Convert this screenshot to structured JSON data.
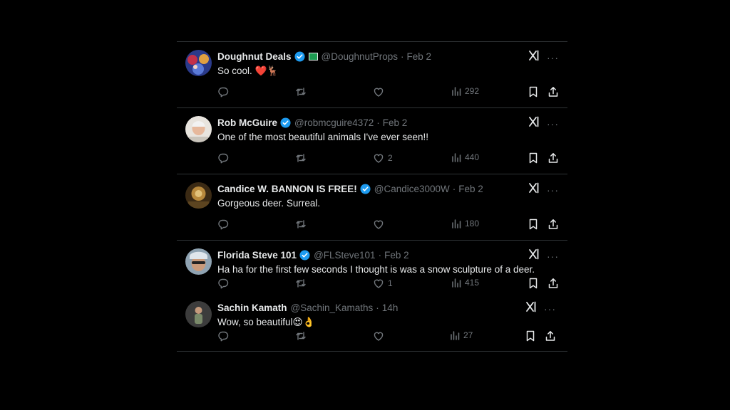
{
  "tweets": [
    {
      "name": "Doughnut Deals",
      "handle": "@DoughnutProps",
      "date": "Feb 2",
      "text": "So cool. ❤️🦌",
      "verified": true,
      "affiliate_badge": true,
      "reply_count": "",
      "retweet_count": "",
      "like_count": "",
      "views": "292",
      "avatar_color": "#3a4f9a"
    },
    {
      "name": "Rob McGuire",
      "handle": "@robmcguire4372",
      "date": "Feb 2",
      "text": "One of the most beautiful animals I've ever seen!!",
      "verified": true,
      "affiliate_badge": false,
      "reply_count": "",
      "retweet_count": "",
      "like_count": "2",
      "views": "440",
      "avatar_color": "#d9d2c9"
    },
    {
      "name": "Candice W. BANNON IS FREE!",
      "handle": "@Candice3000W",
      "date": "Feb 2",
      "text": "Gorgeous deer. Surreal.",
      "verified": true,
      "affiliate_badge": false,
      "reply_count": "",
      "retweet_count": "",
      "like_count": "",
      "views": "180",
      "avatar_color": "#8a6a2e"
    },
    {
      "name": "Florida Steve 101",
      "handle": "@FLSteve101",
      "date": "Feb 2",
      "text": "Ha ha for the first few seconds I thought is was a snow sculpture of a deer.",
      "verified": true,
      "affiliate_badge": false,
      "reply_count": "",
      "retweet_count": "",
      "like_count": "1",
      "views": "415",
      "avatar_color": "#6c7a86"
    },
    {
      "name": "Sachin Kamath",
      "handle": "@Sachin_Kamaths",
      "date": "14h",
      "text": "Wow, so beautiful😍👌",
      "verified": false,
      "affiliate_badge": false,
      "reply_count": "",
      "retweet_count": "",
      "like_count": "",
      "views": "27",
      "avatar_color": "#4d4d4d"
    }
  ],
  "separator": "·",
  "more_label": "···",
  "colors": {
    "background": "#000000",
    "text": "#e7e9ea",
    "muted": "#71767b",
    "border": "#2f3336",
    "verified_blue": "#1d9bf0",
    "heart_red": "#f91880"
  },
  "icons": [
    "reply-icon",
    "retweet-icon",
    "like-icon",
    "views-icon",
    "bookmark-icon",
    "share-icon",
    "grok-icon",
    "more-icon",
    "verified-badge-icon"
  ]
}
